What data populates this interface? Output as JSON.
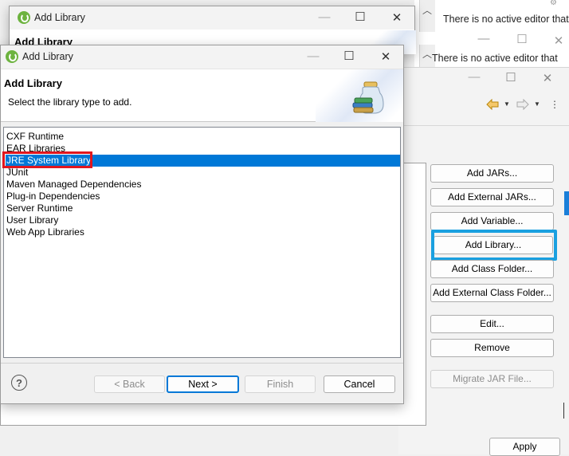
{
  "background": {
    "no_editor_text_1": "There is no active editor that",
    "no_editor_text_2": "There is no active editor that"
  },
  "properties_window": {
    "buttons": {
      "add_jars": "Add JARs...",
      "add_external_jars": "Add External JARs...",
      "add_variable": "Add Variable...",
      "add_library": "Add Library...",
      "add_class_folder": "Add Class Folder...",
      "add_external_class_folder": "Add External Class Folder...",
      "edit": "Edit...",
      "remove": "Remove",
      "migrate_jar": "Migrate JAR File...",
      "apply": "Apply"
    },
    "highlight_color": "#1aa0e0"
  },
  "back_dialog": {
    "title": "Add Library",
    "header_title": "Add Library"
  },
  "dialog": {
    "title": "Add Library",
    "header_title": "Add Library",
    "header_subtitle": "Select the library type to add.",
    "library_types": [
      "CXF Runtime",
      "EAR Libraries",
      "JRE System Library",
      "JUnit",
      "Maven Managed Dependencies",
      "Plug-in Dependencies",
      "Server Runtime",
      "User Library",
      "Web App Libraries"
    ],
    "selected_index": 2,
    "selection_color": "#0078d7",
    "annotation_color": "#e0161e",
    "buttons": {
      "help": "?",
      "back": "< Back",
      "next": "Next >",
      "finish": "Finish",
      "cancel": "Cancel"
    }
  },
  "window_controls": {
    "minimize": "—",
    "maximize": "☐",
    "close": "✕"
  },
  "icons": {
    "app": "spring-leaf-icon",
    "wizard_banner": "library-jar-icon",
    "nav_back": "back-arrow-icon",
    "nav_forward": "forward-arrow-icon",
    "view_menu": "kebab-menu-icon"
  }
}
